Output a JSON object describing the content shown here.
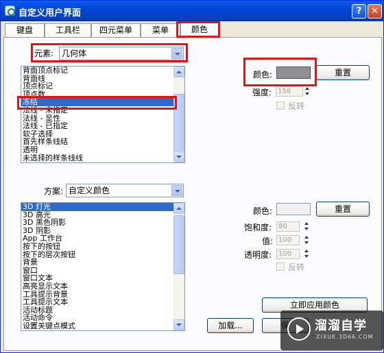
{
  "window": {
    "title": "自定义用户界面",
    "help_label": "?",
    "close_label": "✕"
  },
  "tabs": [
    "键盘",
    "工具栏",
    "四元菜单",
    "菜单",
    "颜色"
  ],
  "element": {
    "label": "元素:",
    "value": "几何体"
  },
  "element_list": [
    "背面顶点标记",
    "背面线",
    "顶点标记",
    "顶点数",
    "冻结",
    "法线 - 未指定",
    "法线 - 显性",
    "法线 - 已指定",
    "软子选择",
    "首先样条线结",
    "透明",
    "未选择的样条线线"
  ],
  "element_selected": "冻结",
  "color_top": {
    "label": "颜色:",
    "swatch_color": "#909094",
    "reset_label": "重置",
    "strength_label": "强度:",
    "strength_value": "158",
    "invert_label": "反转"
  },
  "scheme": {
    "label": "方案:",
    "value": "自定义颜色"
  },
  "scheme_list": [
    "3D 灯光",
    "3D 高光",
    "3D 黑色阴影",
    "3D 阴影",
    "App 工作台",
    "按下的按钮",
    "按下的层次按钮",
    "背景",
    "窗口",
    "窗口文本",
    "高亮显示文本",
    "工具提示背景",
    "工具提示文本",
    "活动标题",
    "活动命令",
    "设置关键点模式"
  ],
  "scheme_selected": "3D 灯光",
  "color_bottom": {
    "label": "颜色:",
    "swatch_color": "#f0f0f0",
    "reset_label": "重置",
    "saturation_label": "饱和度:",
    "saturation_value": "80",
    "value_label": "值:",
    "value_value": "100",
    "transparency_label": "透明度:",
    "transparency_value": "100",
    "invert_label": "反转"
  },
  "buttons": {
    "apply_now": "立即应用颜色",
    "load": "加载...",
    "save": "保"
  },
  "watermark": {
    "title": "溜溜自学",
    "url": "ZIXUE.3D66.COM"
  },
  "colors": {
    "highlight": "#e01414",
    "selection": "#316ac5",
    "titlebar": "#0a5cf0"
  }
}
